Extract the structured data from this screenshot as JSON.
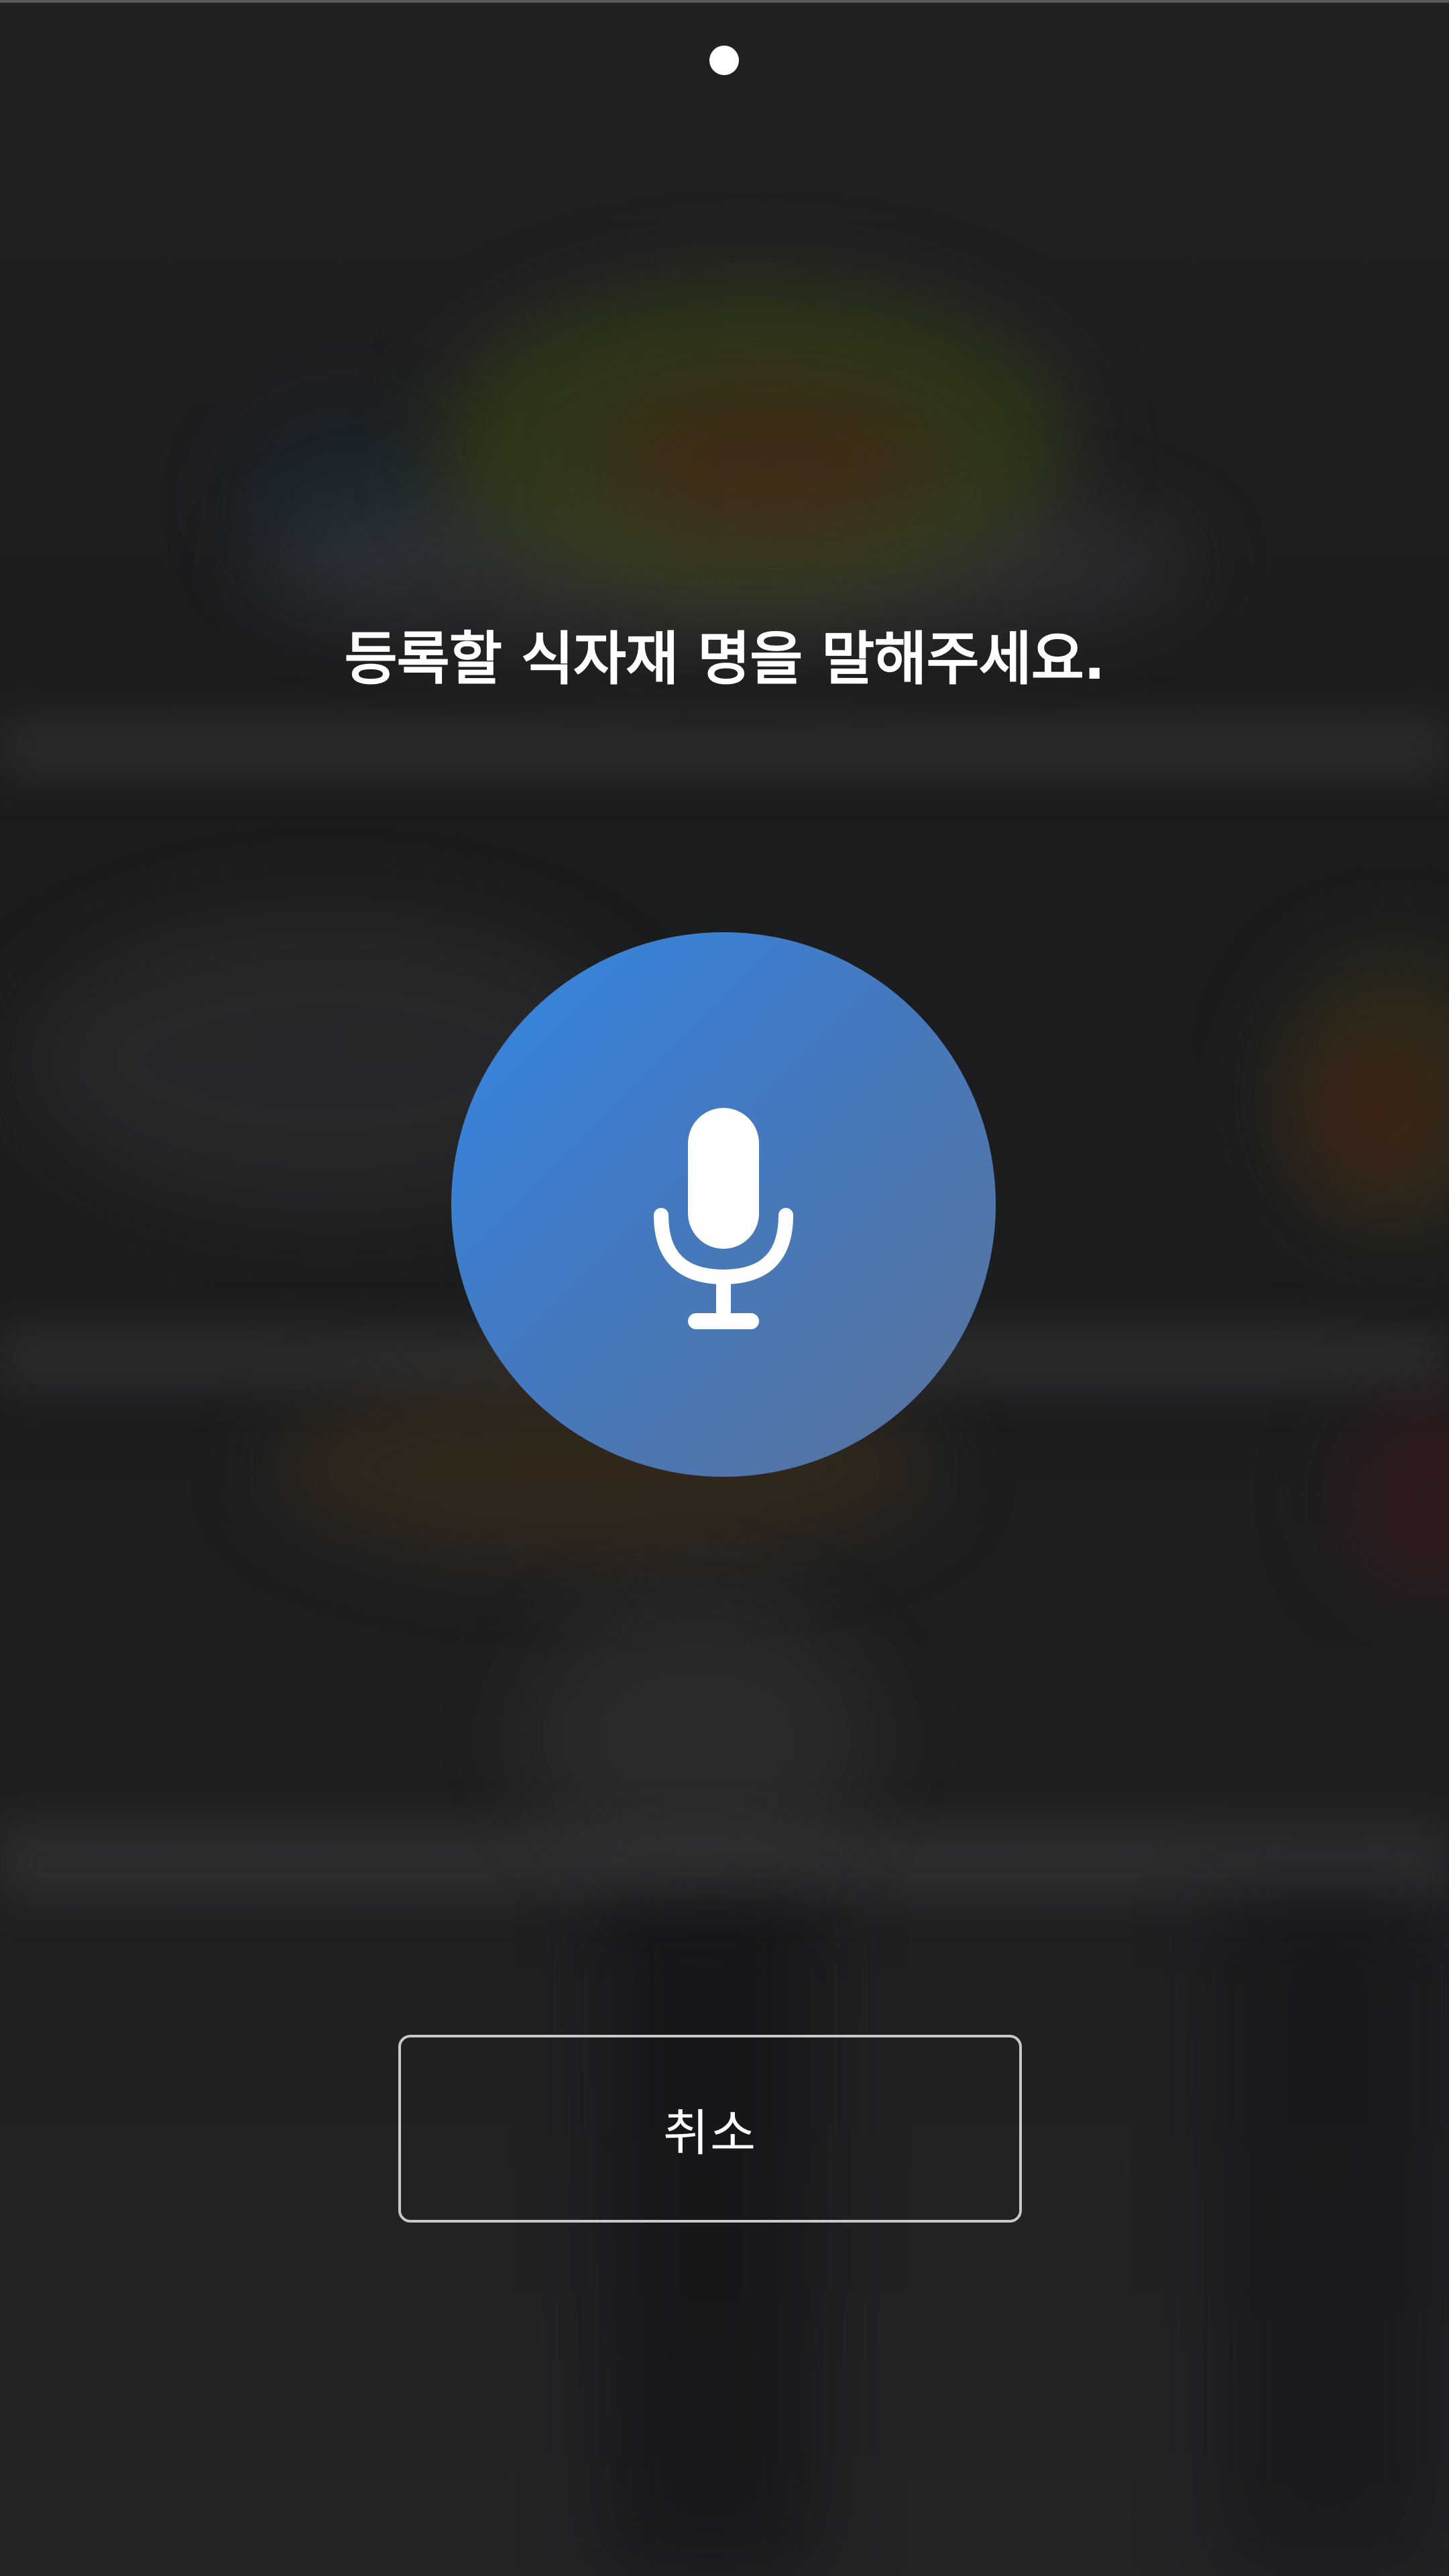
{
  "page_indicator": {
    "count": 1,
    "active_index": 0
  },
  "voice_prompt": {
    "text": "등록할 식자재 명을 말해주세요."
  },
  "mic_button": {
    "icon": "microphone-icon",
    "gradient_start": "#3287e6",
    "gradient_end": "#59739a"
  },
  "cancel_button": {
    "label": "취소"
  },
  "colors": {
    "background": "#1f2022",
    "text": "#ffffff",
    "button_border": "#c9c9cb"
  }
}
